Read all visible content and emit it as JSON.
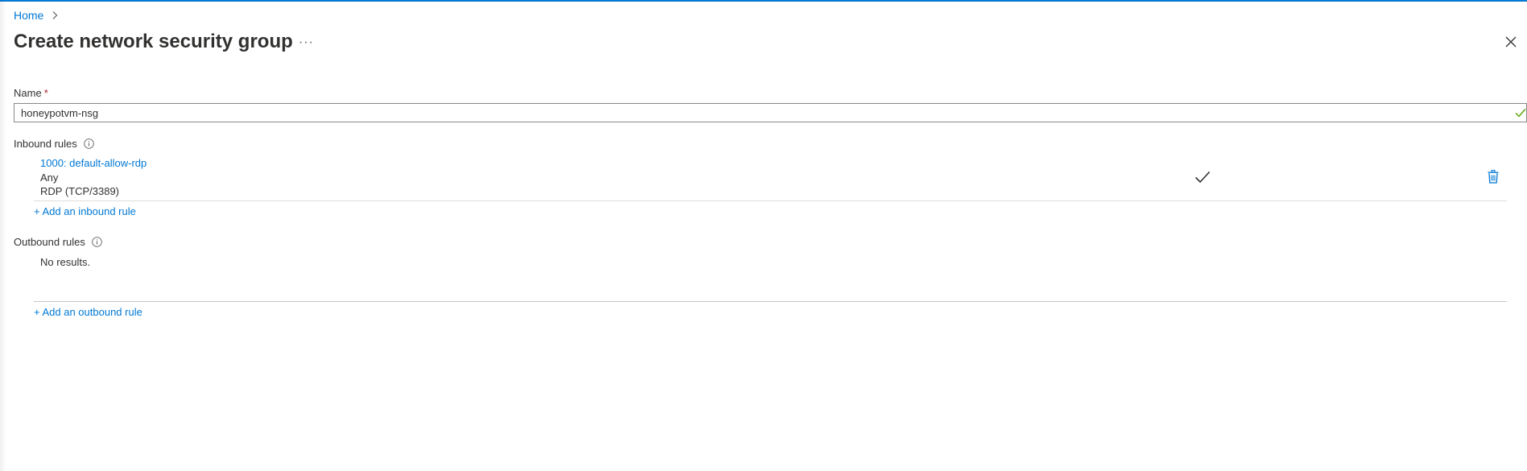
{
  "breadcrumb": {
    "home_label": "Home"
  },
  "header": {
    "title": "Create network security group",
    "more_label": "···"
  },
  "form": {
    "name_label": "Name",
    "required_marker": "*",
    "name_value": "honeypotvm-nsg"
  },
  "inbound": {
    "label": "Inbound rules",
    "rules": [
      {
        "name": "1000: default-allow-rdp",
        "source": "Any",
        "service": "RDP (TCP/3389)"
      }
    ],
    "add_label": "+ Add an inbound rule"
  },
  "outbound": {
    "label": "Outbound rules",
    "empty_text": "No results.",
    "add_label": "+ Add an outbound rule"
  },
  "colors": {
    "accent": "#0078d4",
    "success": "#57a300",
    "required": "#a4262c"
  },
  "icons": [
    "chevron-right-icon",
    "more-icon",
    "close-icon",
    "checkmark-icon",
    "info-icon",
    "trash-icon"
  ]
}
